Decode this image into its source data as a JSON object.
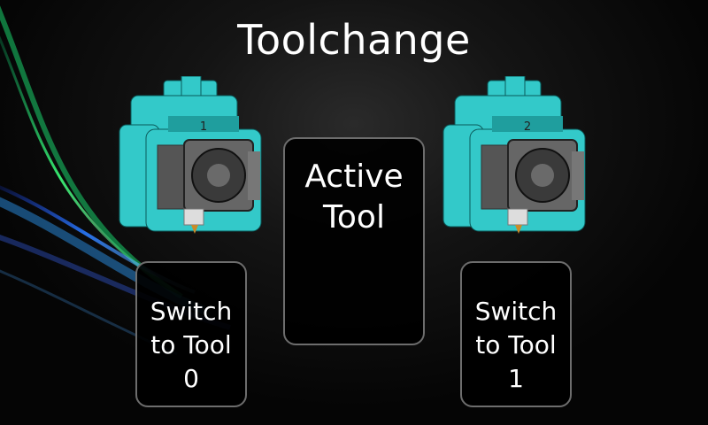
{
  "screen": {
    "title": "Toolchange"
  },
  "tools": [
    {
      "image_icon": "toolhead-0-icon",
      "number_label": "1",
      "switch_button": {
        "line1": "Switch",
        "line2": "to Tool",
        "line3": "0"
      }
    },
    {
      "image_icon": "toolhead-1-icon",
      "number_label": "2",
      "switch_button": {
        "line1": "Switch",
        "line2": "to Tool",
        "line3": "1"
      }
    }
  ],
  "active_tool": {
    "line1": "Active",
    "line2": "Tool"
  },
  "colors": {
    "toolhead_teal": "#33c9c9",
    "toolhead_dark": "#1f9e9e",
    "panel_border": "#6d6d6d",
    "swoosh_green": "#3cff7a",
    "swoosh_blue": "#2a7bff"
  }
}
